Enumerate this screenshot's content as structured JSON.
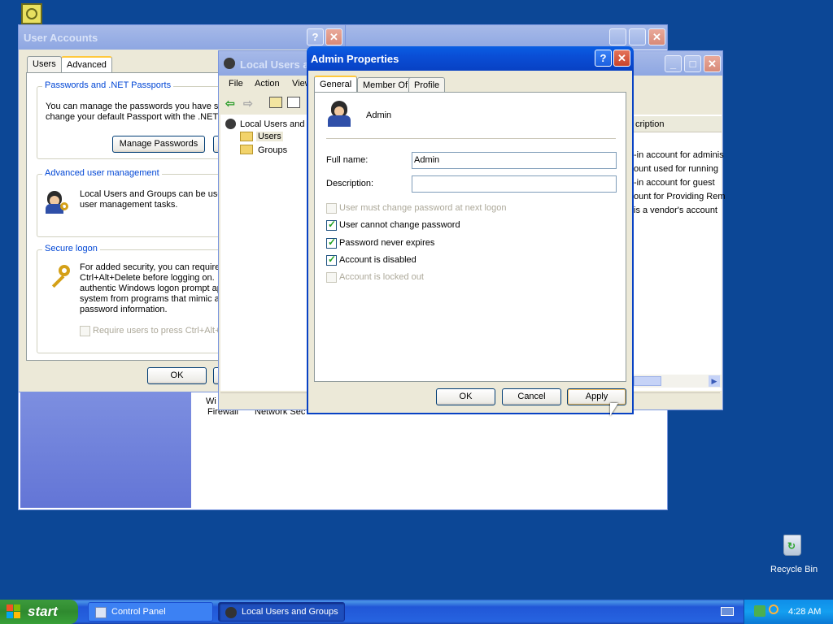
{
  "desktop": {
    "recycle_bin_label": "Recycle Bin"
  },
  "user_accounts": {
    "title": "User Accounts",
    "tabs": [
      "Users",
      "Advanced"
    ],
    "passwords_group": {
      "label": "Passwords and .NET Passports",
      "text_line1": "You can manage the passwords you have st",
      "text_line2": "change your default Passport with the .NET",
      "manage_button": "Manage Passwords"
    },
    "advanced_group": {
      "label": "Advanced user management",
      "text_line1": "Local Users and Groups can be used",
      "text_line2": "user management tasks."
    },
    "secure_group": {
      "label": "Secure logon",
      "text_lines": [
        "For added security, you can require",
        "Ctrl+Alt+Delete before logging on.",
        "authentic Windows logon prompt ap",
        "system from programs that mimic a",
        "password information."
      ],
      "checkbox_label": "Require users to press Ctrl+Alt+"
    },
    "ok_button": "OK"
  },
  "control_panel_bg": {
    "row_text_1": "Wi",
    "row_text_2a": "Firewall",
    "row_text_2b": "Network Sec"
  },
  "lusrmgr": {
    "title": "Local Users a",
    "menu": [
      "File",
      "Action",
      "View"
    ],
    "tree": {
      "root": "Local Users and",
      "users": "Users",
      "groups": "Groups"
    },
    "column_header": "cription",
    "rows": [
      "-in account for adminis",
      "ount used for running",
      "-in account for guest",
      "ount for Providing Rem",
      "is a vendor's account"
    ]
  },
  "admin_props": {
    "title": "Admin Properties",
    "tabs": [
      "General",
      "Member Of",
      "Profile"
    ],
    "user_name": "Admin",
    "full_name_label": "Full name:",
    "full_name_value": "Admin",
    "description_label": "Description:",
    "description_value": "",
    "checkboxes": [
      {
        "label": "User must change password at next logon",
        "checked": false,
        "disabled": true
      },
      {
        "label": "User cannot change password",
        "checked": true,
        "disabled": false
      },
      {
        "label": "Password never expires",
        "checked": true,
        "disabled": false
      },
      {
        "label": "Account is disabled",
        "checked": true,
        "disabled": false
      },
      {
        "label": "Account is locked out",
        "checked": false,
        "disabled": true
      }
    ],
    "ok_button": "OK",
    "cancel_button": "Cancel",
    "apply_button": "Apply"
  },
  "taskbar": {
    "start_label": "start",
    "tasks": [
      "Control Panel",
      "Local Users and Groups"
    ],
    "clock": "4:28 AM"
  },
  "colors": {
    "desktop": "#0c4796",
    "title_active": "#0a4ed6",
    "dialog_bg": "#ece9d8",
    "group_label": "#0046d5"
  }
}
